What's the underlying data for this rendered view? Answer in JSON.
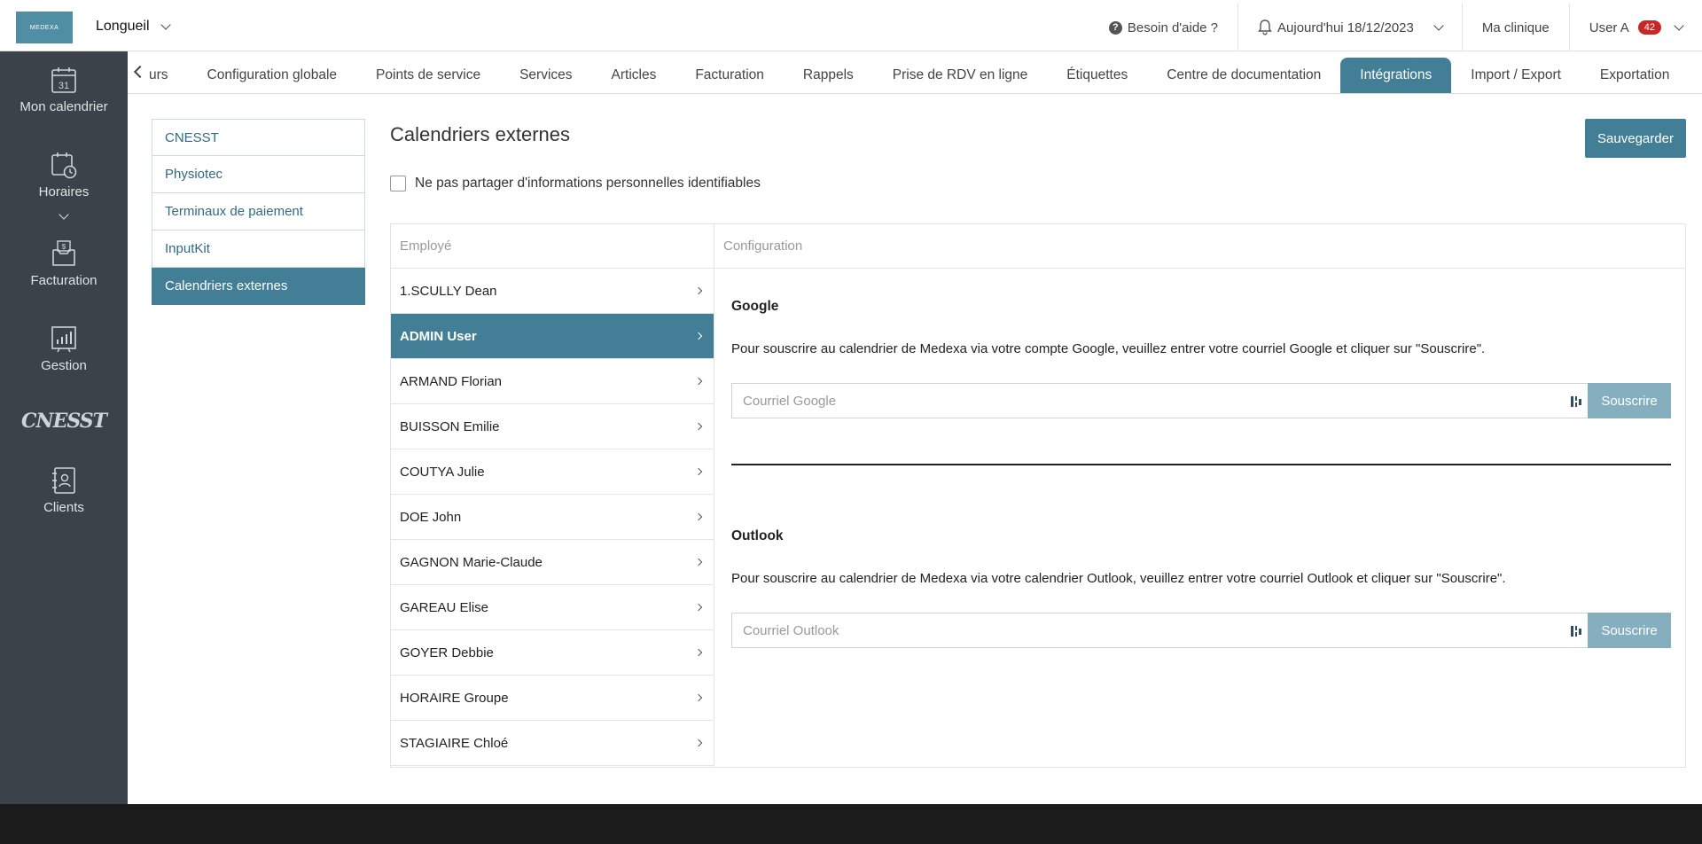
{
  "header": {
    "logo_text": "MEDEXA",
    "location": "Longueil",
    "help": "Besoin d'aide ?",
    "date": "Aujourd'hui 18/12/2023",
    "clinic": "Ma clinique",
    "user": "User A",
    "user_badge": "42"
  },
  "sidebar": {
    "calendar_day": "31",
    "items": [
      {
        "label": "Mon calendrier"
      },
      {
        "label": "Horaires"
      },
      {
        "label": "Facturation"
      },
      {
        "label": "Gestion"
      },
      {
        "label": "CNESST"
      },
      {
        "label": "Clients"
      }
    ]
  },
  "tabs": [
    {
      "label": "urs"
    },
    {
      "label": "Configuration globale"
    },
    {
      "label": "Points de service"
    },
    {
      "label": "Services"
    },
    {
      "label": "Articles"
    },
    {
      "label": "Facturation"
    },
    {
      "label": "Rappels"
    },
    {
      "label": "Prise de RDV en ligne"
    },
    {
      "label": "Étiquettes"
    },
    {
      "label": "Centre de documentation"
    },
    {
      "label": "Intégrations",
      "active": true
    },
    {
      "label": "Import / Export"
    },
    {
      "label": "Exportation"
    }
  ],
  "submenu": [
    {
      "label": "CNESST"
    },
    {
      "label": "Physiotec"
    },
    {
      "label": "Terminaux de paiement"
    },
    {
      "label": "InputKit"
    },
    {
      "label": "Calendriers externes",
      "active": true
    }
  ],
  "main": {
    "title": "Calendriers externes",
    "save_label": "Sauvegarder",
    "checkbox_label": "Ne pas partager d'informations personnelles identifiables",
    "employee_header": "Employé",
    "config_header": "Configuration",
    "employees": [
      {
        "name": "1.SCULLY Dean"
      },
      {
        "name": "ADMIN User",
        "active": true
      },
      {
        "name": "ARMAND Florian"
      },
      {
        "name": "BUISSON Emilie"
      },
      {
        "name": "COUTYA Julie"
      },
      {
        "name": "DOE John"
      },
      {
        "name": "GAGNON Marie-Claude"
      },
      {
        "name": "GAREAU Elise"
      },
      {
        "name": "GOYER Debbie"
      },
      {
        "name": "HORAIRE Groupe"
      },
      {
        "name": "STAGIAIRE Chloé"
      }
    ],
    "google": {
      "title": "Google",
      "description": "Pour souscrire au calendrier de Medexa via votre compte Google, veuillez entrer votre courriel Google et cliquer sur \"Souscrire\".",
      "placeholder": "Courriel Google",
      "button": "Souscrire"
    },
    "outlook": {
      "title": "Outlook",
      "description": "Pour souscrire au calendrier de Medexa via votre calendrier Outlook, veuillez entrer votre courriel Outlook et cliquer sur \"Souscrire\".",
      "placeholder": "Courriel Outlook",
      "button": "Souscrire"
    }
  },
  "colors": {
    "accent": "#427f97",
    "sidebar_bg": "#3b4249",
    "subscribe_btn": "#85aebe",
    "badge": "#c62828"
  }
}
